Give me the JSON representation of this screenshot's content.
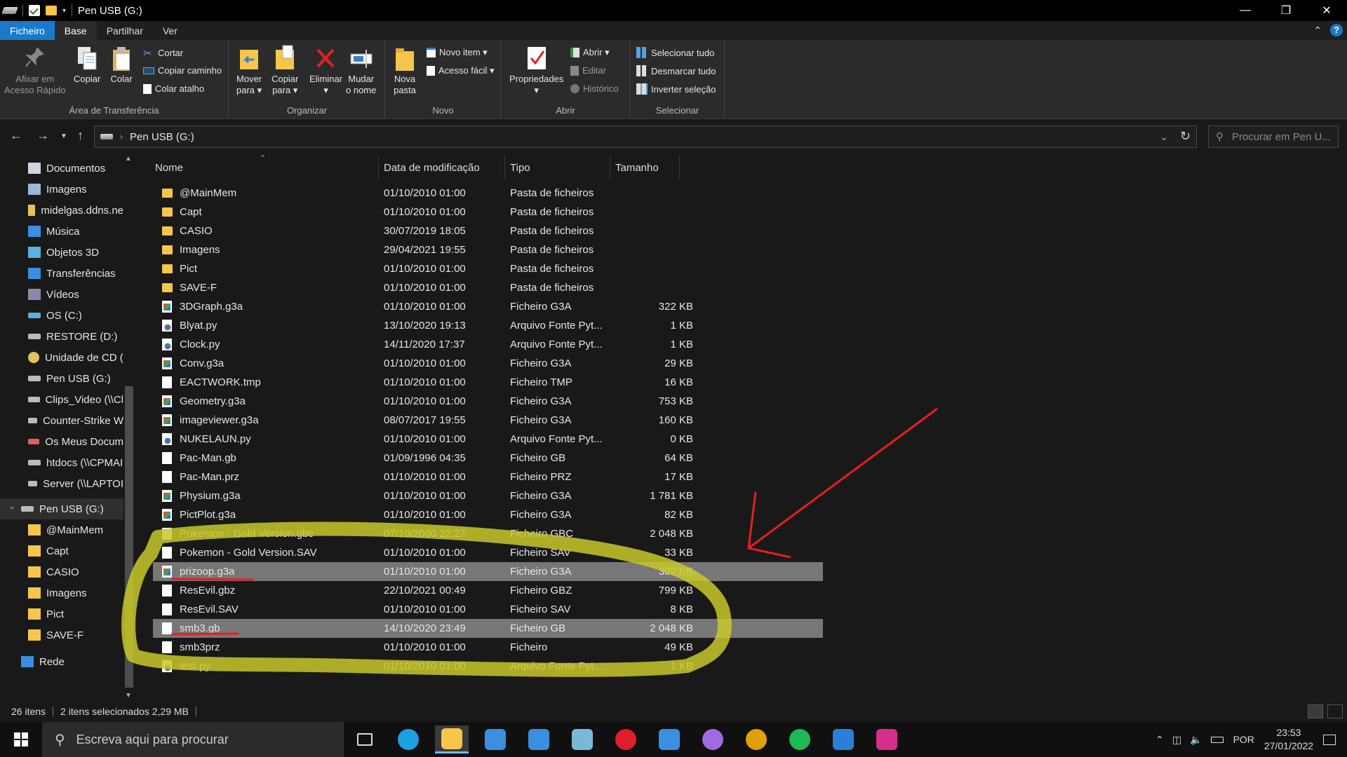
{
  "window": {
    "title": "Pen USB (G:)"
  },
  "ribbon": {
    "tabs": [
      "Ficheiro",
      "Base",
      "Partilhar",
      "Ver"
    ],
    "groups": {
      "clipboard": {
        "label": "Área de Transferência",
        "pin_l1": "Afixar em",
        "pin_l2": "Acesso Rápido",
        "copy": "Copiar",
        "paste": "Colar",
        "cut": "Cortar",
        "copy_path": "Copiar caminho",
        "paste_shortcut": "Colar atalho"
      },
      "organize": {
        "label": "Organizar",
        "move_l1": "Mover",
        "move_l2": "para ▾",
        "copyto_l1": "Copiar",
        "copyto_l2": "para ▾",
        "delete_l1": "Eliminar",
        "delete_l2": "▾",
        "rename_l1": "Mudar",
        "rename_l2": "o nome"
      },
      "new": {
        "label": "Novo",
        "folder_l1": "Nova",
        "folder_l2": "pasta",
        "new_item": "Novo item ▾",
        "easy_access": "Acesso fácil ▾"
      },
      "open": {
        "label": "Abrir",
        "props_l1": "Propriedades",
        "props_l2": "▾",
        "open": "Abrir ▾",
        "edit": "Editar",
        "history": "Histórico"
      },
      "select": {
        "label": "Selecionar",
        "all": "Selecionar tudo",
        "none": "Desmarcar tudo",
        "invert": "Inverter seleção"
      }
    }
  },
  "address": {
    "path": "Pen USB (G:)",
    "search_placeholder": "Procurar em Pen U..."
  },
  "navpane": {
    "items": [
      {
        "label": "Documentos",
        "icon": "documents-icon"
      },
      {
        "label": "Imagens",
        "icon": "pictures-icon"
      },
      {
        "label": "midelgas.ddns.ne",
        "icon": "network-folder-icon"
      },
      {
        "label": "Música",
        "icon": "music-icon"
      },
      {
        "label": "Objetos 3D",
        "icon": "3d-objects-icon"
      },
      {
        "label": "Transferências",
        "icon": "downloads-icon"
      },
      {
        "label": "Vídeos",
        "icon": "videos-icon"
      },
      {
        "label": "OS (C:)",
        "icon": "windows-drive-icon"
      },
      {
        "label": "RESTORE (D:)",
        "icon": "drive-icon"
      },
      {
        "label": "Unidade de CD (",
        "icon": "cd-drive-icon"
      },
      {
        "label": "Pen USB (G:)",
        "icon": "usb-drive-icon"
      },
      {
        "label": "Clips_Video (\\\\Cl",
        "icon": "network-drive-icon"
      },
      {
        "label": "Counter-Strike W",
        "icon": "network-drive-icon"
      },
      {
        "label": "Os Meus Docum",
        "icon": "network-drive-disconnected-icon"
      },
      {
        "label": "htdocs (\\\\CPMAI",
        "icon": "network-drive-icon"
      },
      {
        "label": "Server (\\\\LAPTOI",
        "icon": "network-drive-icon"
      },
      {
        "label": "Pen USB (G:)",
        "icon": "usb-drive-icon"
      },
      {
        "label": "@MainMem",
        "icon": "folder-icon"
      },
      {
        "label": "Capt",
        "icon": "folder-icon"
      },
      {
        "label": "CASIO",
        "icon": "folder-icon"
      },
      {
        "label": "Imagens",
        "icon": "folder-icon"
      },
      {
        "label": "Pict",
        "icon": "folder-icon"
      },
      {
        "label": "SAVE-F",
        "icon": "folder-icon"
      },
      {
        "label": "Rede",
        "icon": "network-icon"
      }
    ]
  },
  "columns": {
    "name": "Nome",
    "date": "Data de modificação",
    "type": "Tipo",
    "size": "Tamanho"
  },
  "files": [
    {
      "name": "@MainMem",
      "date": "01/10/2010 01:00",
      "type": "Pasta de ficheiros",
      "size": "",
      "kind": "folder"
    },
    {
      "name": "Capt",
      "date": "01/10/2010 01:00",
      "type": "Pasta de ficheiros",
      "size": "",
      "kind": "folder"
    },
    {
      "name": "CASIO",
      "date": "30/07/2019 18:05",
      "type": "Pasta de ficheiros",
      "size": "",
      "kind": "folder"
    },
    {
      "name": "Imagens",
      "date": "29/04/2021 19:55",
      "type": "Pasta de ficheiros",
      "size": "",
      "kind": "folder"
    },
    {
      "name": "Pict",
      "date": "01/10/2010 01:00",
      "type": "Pasta de ficheiros",
      "size": "",
      "kind": "folder"
    },
    {
      "name": "SAVE-F",
      "date": "01/10/2010 01:00",
      "type": "Pasta de ficheiros",
      "size": "",
      "kind": "folder"
    },
    {
      "name": "3DGraph.g3a",
      "date": "01/10/2010 01:00",
      "type": "Ficheiro G3A",
      "size": "322 KB",
      "kind": "g3a"
    },
    {
      "name": "Blyat.py",
      "date": "13/10/2020 19:13",
      "type": "Arquivo Fonte Pyt...",
      "size": "1 KB",
      "kind": "py"
    },
    {
      "name": "Clock.py",
      "date": "14/11/2020 17:37",
      "type": "Arquivo Fonte Pyt...",
      "size": "1 KB",
      "kind": "py"
    },
    {
      "name": "Conv.g3a",
      "date": "01/10/2010 01:00",
      "type": "Ficheiro G3A",
      "size": "29 KB",
      "kind": "g3a"
    },
    {
      "name": "EACTWORK.tmp",
      "date": "01/10/2010 01:00",
      "type": "Ficheiro TMP",
      "size": "16 KB",
      "kind": "doc"
    },
    {
      "name": "Geometry.g3a",
      "date": "01/10/2010 01:00",
      "type": "Ficheiro G3A",
      "size": "753 KB",
      "kind": "g3a"
    },
    {
      "name": "imageviewer.g3a",
      "date": "08/07/2017 19:55",
      "type": "Ficheiro G3A",
      "size": "160 KB",
      "kind": "g3a"
    },
    {
      "name": "NUKELAUN.py",
      "date": "01/10/2010 01:00",
      "type": "Arquivo Fonte Pyt...",
      "size": "0 KB",
      "kind": "py"
    },
    {
      "name": "Pac-Man.gb",
      "date": "01/09/1996 04:35",
      "type": "Ficheiro GB",
      "size": "64 KB",
      "kind": "doc"
    },
    {
      "name": "Pac-Man.prz",
      "date": "01/10/2010 01:00",
      "type": "Ficheiro PRZ",
      "size": "17 KB",
      "kind": "doc"
    },
    {
      "name": "Physium.g3a",
      "date": "01/10/2010 01:00",
      "type": "Ficheiro G3A",
      "size": "1 781 KB",
      "kind": "g3a"
    },
    {
      "name": "PictPlot.g3a",
      "date": "01/10/2010 01:00",
      "type": "Ficheiro G3A",
      "size": "82 KB",
      "kind": "g3a"
    },
    {
      "name": "Pokemon - Gold Version.gbc",
      "date": "07/10/2000 22:27",
      "type": "Ficheiro GBC",
      "size": "2 048 KB",
      "kind": "doc"
    },
    {
      "name": "Pokemon - Gold Version.SAV",
      "date": "01/10/2010 01:00",
      "type": "Ficheiro SAV",
      "size": "33 KB",
      "kind": "doc"
    },
    {
      "name": "prizoop.g3a",
      "date": "01/10/2010 01:00",
      "type": "Ficheiro G3A",
      "size": "302 KB",
      "kind": "g3a",
      "selected": true
    },
    {
      "name": "ResEvil.gbz",
      "date": "22/10/2021 00:49",
      "type": "Ficheiro GBZ",
      "size": "799 KB",
      "kind": "doc"
    },
    {
      "name": "ResEvil.SAV",
      "date": "01/10/2010 01:00",
      "type": "Ficheiro SAV",
      "size": "8 KB",
      "kind": "doc"
    },
    {
      "name": "smb3.gb",
      "date": "14/10/2020 23:49",
      "type": "Ficheiro GB",
      "size": "2 048 KB",
      "kind": "doc",
      "selected": true
    },
    {
      "name": "smb3prz",
      "date": "01/10/2010 01:00",
      "type": "Ficheiro",
      "size": "49 KB",
      "kind": "doc"
    },
    {
      "name": "test.py",
      "date": "01/10/2010 01:00",
      "type": "Arquivo Fonte Pyt...",
      "size": "1 KB",
      "kind": "py"
    }
  ],
  "status": {
    "count": "26 itens",
    "selection": "2 itens selecionados  2,29 MB"
  },
  "taskbar": {
    "search_placeholder": "Escreva aqui para procurar",
    "apps": [
      "task-view-icon",
      "edge-icon",
      "file-explorer-icon",
      "mail-icon",
      "store-icon",
      "note-icon",
      "opera-icon",
      "remote-desktop-icon",
      "messenger-icon",
      "chrome-icon",
      "spotify-icon",
      "vscode-icon",
      "instagram-icon"
    ],
    "language": "POR",
    "time": "23:53",
    "date": "27/01/2022"
  },
  "colors": {
    "accent": "#1979ca",
    "highlight": "#c8c82a",
    "arrow": "#e81e1e"
  }
}
